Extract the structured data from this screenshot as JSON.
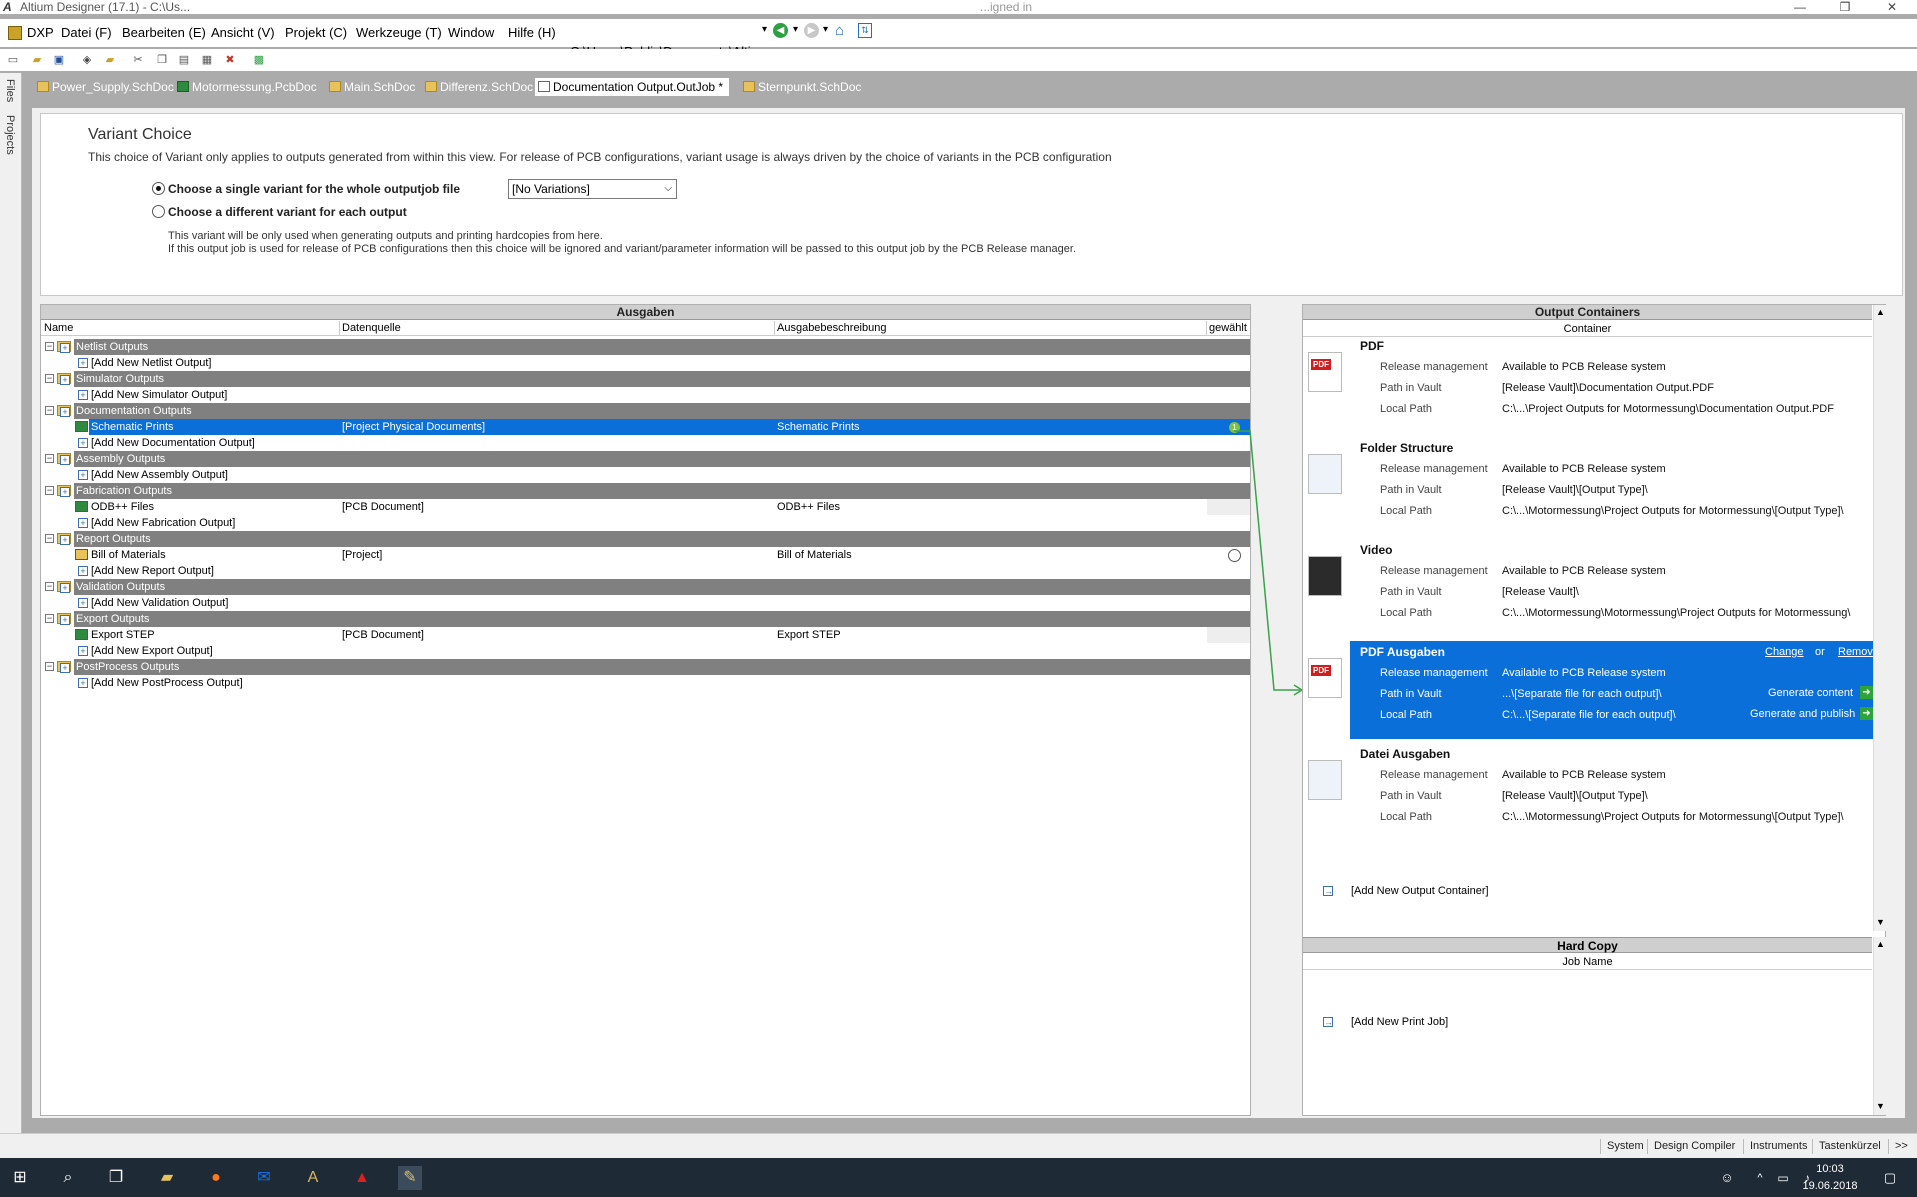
{
  "window": {
    "title": "Altium Designer (17.1) - C:\\Us...",
    "right_title": "...igned in"
  },
  "menu": [
    "DXP",
    "Datei (F)",
    "Bearbeiten (E)",
    "Ansicht (V)",
    "Projekt (C)",
    "Werkzeuge (T)",
    "Window",
    "Hilfe (H)"
  ],
  "path_box": "C:\\Users\\Public\\Documents\\Altiur",
  "sidebar_tabs": [
    "Files",
    "Projects"
  ],
  "tabs": [
    {
      "label": "Power_Supply.SchDoc",
      "kind": "sch"
    },
    {
      "label": "Motormessung.PcbDoc",
      "kind": "pcb"
    },
    {
      "label": "Main.SchDoc",
      "kind": "sch"
    },
    {
      "label": "Differenz.SchDoc",
      "kind": "sch"
    },
    {
      "label": "Documentation Output.OutJob *",
      "kind": "out",
      "active": true
    },
    {
      "label": "Sternpunkt.SchDoc",
      "kind": "sch"
    }
  ],
  "variant": {
    "title": "Variant Choice",
    "subtitle": "This choice of Variant only applies to outputs generated from within this view. For release of PCB configurations, variant usage is always driven by the choice of variants in the PCB configuration",
    "option1": "Choose a single variant for the whole outputjob file",
    "option2": "Choose a different variant for each output",
    "select_value": "[No Variations]",
    "note1": "This variant will be only used when generating outputs and printing hardcopies from here.",
    "note2": "If this output job is used for release of PCB configurations then this choice will be ignored and variant/parameter information will be passed to this output job by the PCB Release manager."
  },
  "outputs": {
    "header": "Ausgaben",
    "columns": [
      "Name",
      "Datenquelle",
      "Ausgabebeschreibung",
      "gewählt"
    ],
    "rows": [
      {
        "type": "cat",
        "name": "Netlist Outputs"
      },
      {
        "type": "add",
        "name": "[Add New Netlist Output]"
      },
      {
        "type": "cat",
        "name": "Simulator Outputs"
      },
      {
        "type": "add",
        "name": "[Add New Simulator Output]"
      },
      {
        "type": "cat",
        "name": "Documentation Outputs"
      },
      {
        "type": "item",
        "name": "Schematic Prints",
        "source": "[Project Physical Documents]",
        "desc": "Schematic Prints",
        "selected": true,
        "badge": "1"
      },
      {
        "type": "add",
        "name": "[Add New Documentation Output]"
      },
      {
        "type": "cat",
        "name": "Assembly Outputs"
      },
      {
        "type": "add",
        "name": "[Add New Assembly Output]"
      },
      {
        "type": "cat",
        "name": "Fabrication Outputs"
      },
      {
        "type": "item",
        "name": "ODB++ Files",
        "source": "[PCB Document]",
        "desc": "ODB++ Files"
      },
      {
        "type": "add",
        "name": "[Add New Fabrication Output]"
      },
      {
        "type": "cat",
        "name": "Report Outputs"
      },
      {
        "type": "item",
        "name": "Bill of Materials",
        "source": "[Project]",
        "desc": "Bill of Materials",
        "radio": true
      },
      {
        "type": "add",
        "name": "[Add New Report Output]"
      },
      {
        "type": "cat",
        "name": "Validation Outputs"
      },
      {
        "type": "add",
        "name": "[Add New Validation Output]"
      },
      {
        "type": "cat",
        "name": "Export Outputs"
      },
      {
        "type": "item",
        "name": "Export STEP",
        "source": "[PCB Document]",
        "desc": "Export STEP"
      },
      {
        "type": "add",
        "name": "[Add New Export Output]"
      },
      {
        "type": "cat",
        "name": "PostProcess Outputs"
      },
      {
        "type": "add",
        "name": "[Add New PostProcess Output]"
      }
    ]
  },
  "containers": {
    "header": "Output Containers",
    "subheader": "Container",
    "key_release": "Release management",
    "key_vault": "Path in Vault",
    "key_local": "Local Path",
    "items": [
      {
        "title": "PDF",
        "icon": "pdf",
        "release": "Available to PCB Release system",
        "vault": "[Release Vault]\\Documentation Output.PDF",
        "local": "C:\\...\\Project Outputs for Motormessung\\Documentation Output.PDF"
      },
      {
        "title": "Folder Structure",
        "icon": "doc",
        "release": "Available to PCB Release system",
        "vault": "[Release Vault]\\[Output Type]\\",
        "local": "C:\\...\\Motormessung\\Project Outputs for Motormessung\\[Output Type]\\"
      },
      {
        "title": "Video",
        "icon": "video",
        "release": "Available to PCB Release system",
        "vault": "[Release Vault]\\",
        "local": "C:\\...\\Motormessung\\Motormessung\\Project Outputs for Motormessung\\"
      },
      {
        "title": "PDF Ausgaben",
        "icon": "pdf",
        "release": "Available to PCB Release system",
        "vault": "...\\[Separate file for each output]\\",
        "local": "C:\\...\\[Separate file for each output]\\",
        "selected": true
      },
      {
        "title": "Datei Ausgaben",
        "icon": "doc",
        "release": "Available to PCB Release system",
        "vault": "[Release Vault]\\[Output Type]\\",
        "local": "C:\\...\\Motormessung\\Project Outputs for Motormessung\\[Output Type]\\"
      }
    ],
    "change": "Change",
    "or": "or",
    "remove": "Remove",
    "generate_content": "Generate content",
    "generate_publish": "Generate and publish",
    "add_container": "[Add New Output Container]"
  },
  "hardcopy": {
    "header": "Hard Copy",
    "subheader": "Job Name",
    "add_job": "[Add New Print Job]"
  },
  "statusbar": [
    "System",
    "Design Compiler",
    "Instruments",
    "Tastenkürzel",
    ">>"
  ],
  "clock": {
    "time": "10:03",
    "date": "19.06.2018"
  },
  "colors": {
    "accent": "#0a6fd8",
    "category": "#808080",
    "link_line": "#3aa14a"
  }
}
